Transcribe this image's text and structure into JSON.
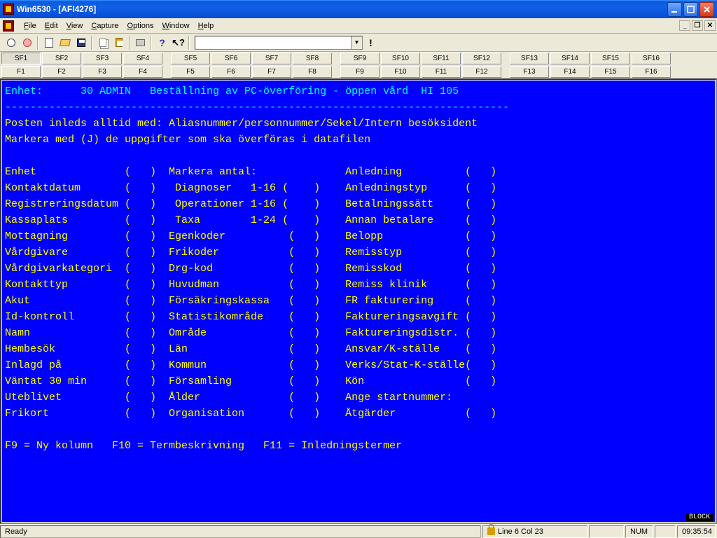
{
  "window": {
    "title": "Win6530 - [AFI4276]"
  },
  "menu": {
    "file": "File",
    "edit": "Edit",
    "view": "View",
    "capture": "Capture",
    "options": "Options",
    "window": "Window",
    "help": "Help"
  },
  "sf_row1": [
    "SF1",
    "SF2",
    "SF3",
    "SF4",
    "SF5",
    "SF6",
    "SF7",
    "SF8",
    "SF9",
    "SF10",
    "SF11",
    "SF12",
    "SF13",
    "SF14",
    "SF15",
    "SF16"
  ],
  "sf_row2": [
    "F1",
    "F2",
    "F3",
    "F4",
    "F5",
    "F6",
    "F7",
    "F8",
    "F9",
    "F10",
    "F11",
    "F12",
    "F13",
    "F14",
    "F15",
    "F16"
  ],
  "terminal": {
    "line1": "Enhet:      30 ADMIN   Beställning av PC-överföring - öppen vård  HI 105",
    "line2": "--------------------------------------------------------------------------------",
    "line3": "Posten inleds alltid med: Aliasnummer/personnummer/Sekel/Intern besöksident",
    "line4": "Markera med (J) de uppgifter som ska överföras i datafilen",
    "blank": " ",
    "col_hdr_mid": "Markera antal:",
    "rows": [
      {
        "c1": "Enhet",
        "c2": "Markera antal:",
        "c2v": "",
        "c3": "Anledning"
      },
      {
        "c1": "Kontaktdatum",
        "c2": " Diagnoser   1-16",
        "c3": "Anledningstyp"
      },
      {
        "c1": "Registreringsdatum",
        "c2": " Operationer 1-16",
        "c3": "Betalningssätt"
      },
      {
        "c1": "Kassaplats",
        "c2": " Taxa        1-24",
        "c3": "Annan betalare"
      },
      {
        "c1": "Mottagning",
        "c2": "Egenkoder",
        "c3": "Belopp"
      },
      {
        "c1": "Vårdgivare",
        "c2": "Frikoder",
        "c3": "Remisstyp"
      },
      {
        "c1": "Vårdgivarkategori",
        "c2": "Drg-kod",
        "c3": "Remisskod"
      },
      {
        "c1": "Kontakttyp",
        "c2": "Huvudman",
        "c3": "Remiss klinik"
      },
      {
        "c1": "Akut",
        "c2": "Försäkringskassa",
        "c3": "FR fakturering"
      },
      {
        "c1": "Id-kontroll",
        "c2": "Statistikområde",
        "c3": "Faktureringsavgift"
      },
      {
        "c1": "Namn",
        "c2": "Område",
        "c3": "Faktureringsdistr."
      },
      {
        "c1": "Hembesök",
        "c2": "Län",
        "c3": "Ansvar/K-ställe"
      },
      {
        "c1": "Inlagd på",
        "c2": "Kommun",
        "c3": "Verks/Stat-K-ställe"
      },
      {
        "c1": "Väntat 30 min",
        "c2": "Församling",
        "c3": "Kön"
      },
      {
        "c1": "Uteblivet",
        "c2": "Ålder",
        "c3": "Ange startnummer:",
        "no3p": true
      },
      {
        "c1": "Frikort",
        "c2": "Organisation",
        "c3": "Åtgärder"
      }
    ],
    "footer": "F9 = Ny kolumn   F10 = Termbeskrivning   F11 = Inledningstermer"
  },
  "status": {
    "ready": "Ready",
    "pos": "Line 6 Col 23",
    "num": "NUM",
    "time": "09:35:54",
    "block": "BLOCK"
  }
}
